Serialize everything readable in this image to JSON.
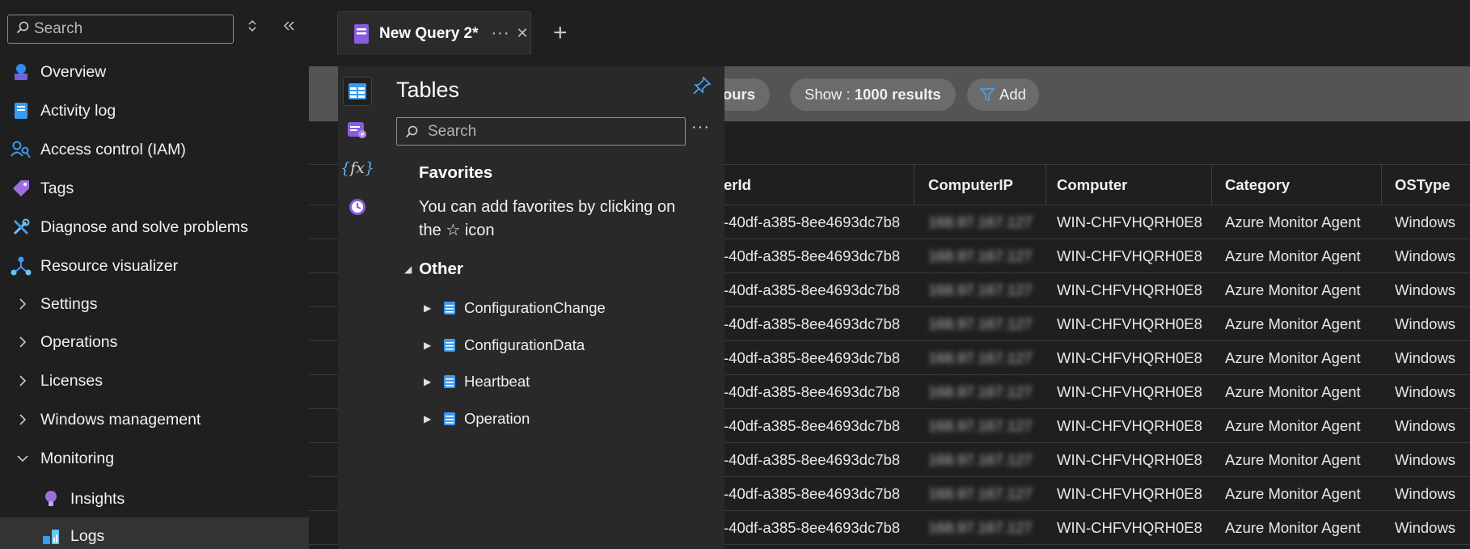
{
  "sidebar": {
    "search_placeholder": "Search",
    "items": [
      {
        "label": "Overview"
      },
      {
        "label": "Activity log"
      },
      {
        "label": "Access control (IAM)"
      },
      {
        "label": "Tags"
      },
      {
        "label": "Diagnose and solve problems"
      },
      {
        "label": "Resource visualizer"
      },
      {
        "label": "Settings"
      },
      {
        "label": "Operations"
      },
      {
        "label": "Licenses"
      },
      {
        "label": "Windows management"
      },
      {
        "label": "Monitoring"
      },
      {
        "label": "Insights"
      },
      {
        "label": "Logs"
      }
    ]
  },
  "tabs": {
    "active_label": "New Query 2*",
    "more": "···",
    "close": "✕",
    "new_tab": "+"
  },
  "flyout": {
    "title": "Tables",
    "search_placeholder": "Search",
    "more": "···",
    "favorites_title": "Favorites",
    "favorites_desc": "You can add favorites by clicking on the ☆ icon",
    "other_title": "Other",
    "tables": [
      "ConfigurationChange",
      "ConfigurationData",
      "Heartbeat",
      "Operation"
    ]
  },
  "toolbar": {
    "time_range_partial": "hours",
    "show_prefix": "Show : ",
    "show_value": "1000 results",
    "add_label": "Add"
  },
  "grid": {
    "columns": [
      "erId",
      "ComputerIP",
      "Computer",
      "Category",
      "OSType"
    ],
    "rows": [
      [
        "-40df-a385-8ee4693dc7b8",
        "168.97.167.127",
        "WIN-CHFVHQRH0E8",
        "Azure Monitor Agent",
        "Windows"
      ],
      [
        "-40df-a385-8ee4693dc7b8",
        "168.97.167.127",
        "WIN-CHFVHQRH0E8",
        "Azure Monitor Agent",
        "Windows"
      ],
      [
        "-40df-a385-8ee4693dc7b8",
        "168.97.167.127",
        "WIN-CHFVHQRH0E8",
        "Azure Monitor Agent",
        "Windows"
      ],
      [
        "-40df-a385-8ee4693dc7b8",
        "168.97.167.127",
        "WIN-CHFVHQRH0E8",
        "Azure Monitor Agent",
        "Windows"
      ],
      [
        "-40df-a385-8ee4693dc7b8",
        "168.97.167.127",
        "WIN-CHFVHQRH0E8",
        "Azure Monitor Agent",
        "Windows"
      ],
      [
        "-40df-a385-8ee4693dc7b8",
        "168.97.167.127",
        "WIN-CHFVHQRH0E8",
        "Azure Monitor Agent",
        "Windows"
      ],
      [
        "-40df-a385-8ee4693dc7b8",
        "168.97.167.127",
        "WIN-CHFVHQRH0E8",
        "Azure Monitor Agent",
        "Windows"
      ],
      [
        "-40df-a385-8ee4693dc7b8",
        "168.97.167.127",
        "WIN-CHFVHQRH0E8",
        "Azure Monitor Agent",
        "Windows"
      ],
      [
        "-40df-a385-8ee4693dc7b8",
        "168.97.167.127",
        "WIN-CHFVHQRH0E8",
        "Azure Monitor Agent",
        "Windows"
      ],
      [
        "-40df-a385-8ee4693dc7b8",
        "168.97.167.127",
        "WIN-CHFVHQRH0E8",
        "Azure Monitor Agent",
        "Windows"
      ]
    ]
  },
  "colors": {
    "accent": "#4ba3f5",
    "selected_row": "#333333",
    "flyout_bg": "#292929",
    "toolbar_bg": "#545454"
  }
}
